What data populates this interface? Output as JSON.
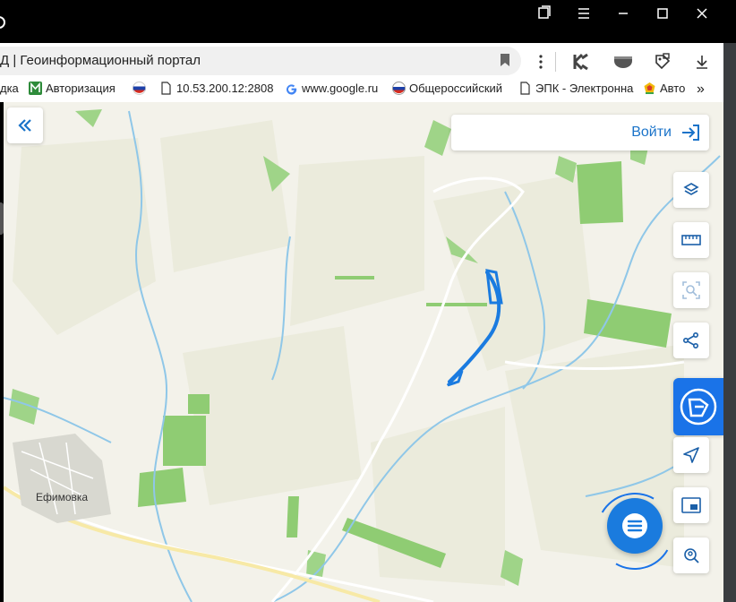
{
  "titlebar": {
    "controls": [
      "bookmark-tab-icon",
      "menu-icon",
      "minimize-icon",
      "maximize-icon",
      "close-icon"
    ]
  },
  "browser": {
    "address_text": "Д | Геоинформационный портал",
    "bookmarks": [
      {
        "label": "дка",
        "icon": "folder-icon"
      },
      {
        "label": "Авторизация",
        "icon": "m-logo-icon"
      },
      {
        "label": "",
        "icon": "russia-flag-icon"
      },
      {
        "label": "10.53.200.12:2808",
        "icon": "document-icon"
      },
      {
        "label": "www.google.ru",
        "icon": "google-icon"
      },
      {
        "label": "Общероссийский",
        "icon": "russia-globe-icon"
      },
      {
        "label": "ЭПК - Электронна",
        "icon": "document-icon"
      },
      {
        "label": "Авто",
        "icon": "colorful-logo-icon"
      }
    ],
    "more_bookmarks": "»"
  },
  "map": {
    "login_label": "Войти",
    "town_label": "Ефимовка",
    "colors": {
      "background": "#f3f2ea",
      "fields": "#8fcc73",
      "water": "#8fc7e8",
      "roads": "#ffffff",
      "highway": "#f7e9a6",
      "route": "#1a7be0",
      "accent": "#1a73e8"
    },
    "tools": [
      "layers-icon",
      "ruler-icon",
      "area-select-icon",
      "share-icon",
      "brand-logo-icon",
      "locate-icon",
      "minimap-icon",
      "search-location-icon"
    ]
  }
}
